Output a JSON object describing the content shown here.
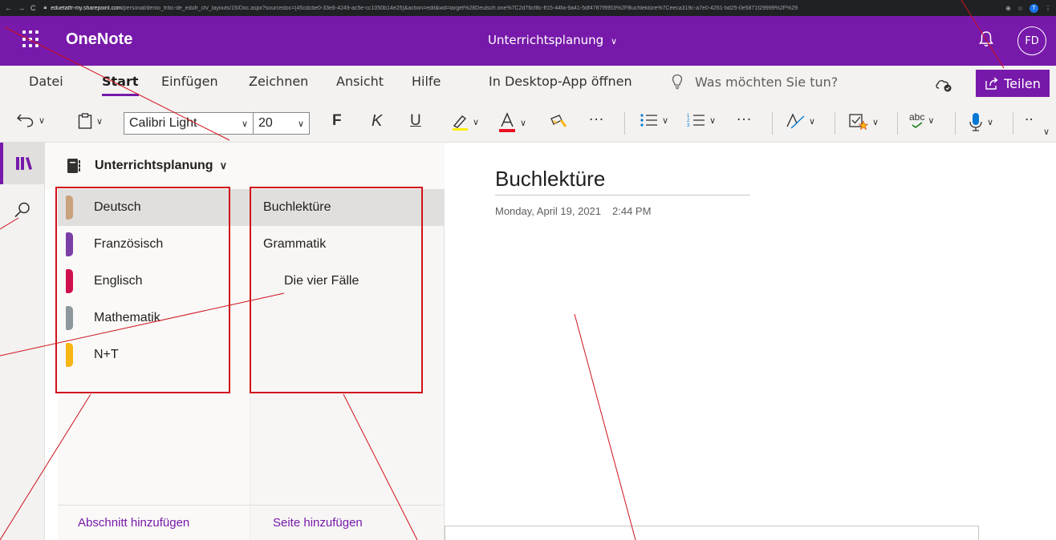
{
  "browser": {
    "url_host": "eduetatfr-my.sharepoint.com",
    "url_rest": "/personal/demo_fritic-de_edufr_ch/_layouts/15/Doc.aspx?sourcedoc={45cdcbe0-33e8-4249-ac5e-cc1050b14e25}&action=edit&wd=target%28Deutsch.one%7C2d76cf8c-ff15-44fa-9a41-5df4787f9953%2FBuchlektüre%7Ceeca319c-a7e0-4261-bd25-0e5871f29999%2F%29",
    "profile_initial": "T"
  },
  "app": {
    "name": "OneNote",
    "notebook_title": "Unterrichtsplanung",
    "avatar": "FD"
  },
  "ribbon": {
    "tabs": [
      "Datei",
      "Start",
      "Einfügen",
      "Zeichnen",
      "Ansicht",
      "Hilfe",
      "In Desktop-App öffnen"
    ],
    "active_tab": "Start",
    "tell_me": "Was möchten Sie tun?",
    "share": "Teilen",
    "font_name": "Calibri Light",
    "font_size": "20",
    "bold": "F",
    "italic": "K",
    "underline": "U",
    "more": "···",
    "spell": "abc",
    "highlight_color": "#ffee00",
    "font_color": "#e81123"
  },
  "navigation": {
    "notebook_name": "Unterrichtsplanung",
    "sections": [
      {
        "label": "Deutsch",
        "color": "#c8a27c"
      },
      {
        "label": "Französisch",
        "color": "#7b3fa8"
      },
      {
        "label": "Englisch",
        "color": "#d0104c"
      },
      {
        "label": "Mathematik",
        "color": "#8e979c"
      },
      {
        "label": "N+T",
        "color": "#f7b614"
      }
    ],
    "pages": [
      {
        "label": "Buchlektüre"
      },
      {
        "label": "Grammatik"
      },
      {
        "label": "Die vier Fälle"
      }
    ],
    "add_section": "Abschnitt hinzufügen",
    "add_page": "Seite hinzufügen"
  },
  "page": {
    "title": "Buchlektüre",
    "date": "Monday, April 19, 2021",
    "time": "2:44 PM"
  },
  "colors": {
    "brand": "#7719aa",
    "annotation": "#d0121b"
  }
}
